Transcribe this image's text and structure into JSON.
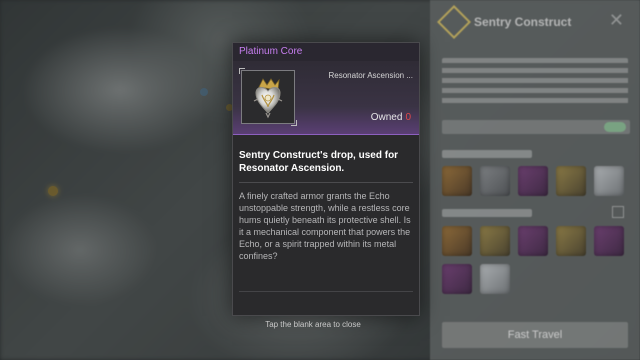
{
  "item": {
    "name": "Platinum Core",
    "usage": "Resonator Ascension ...",
    "owned_label": "Owned",
    "owned_count": "0",
    "description": "Sentry Construct's drop, used for Resonator Ascension.",
    "lore": "A finely crafted armor grants the Echo unstoppable strength, while a restless core hums quietly beneath its protective shell. Is it a mechanical component that powers the Echo, or a spirit trapped within its metal confines?"
  },
  "side_panel": {
    "title": "Sentry Construct",
    "action_button": "Fast Travel"
  },
  "hint": "Tap the blank area to close",
  "colors": {
    "rarity_purple": "#c77ef0",
    "owned_count_red": "#e0484a"
  }
}
